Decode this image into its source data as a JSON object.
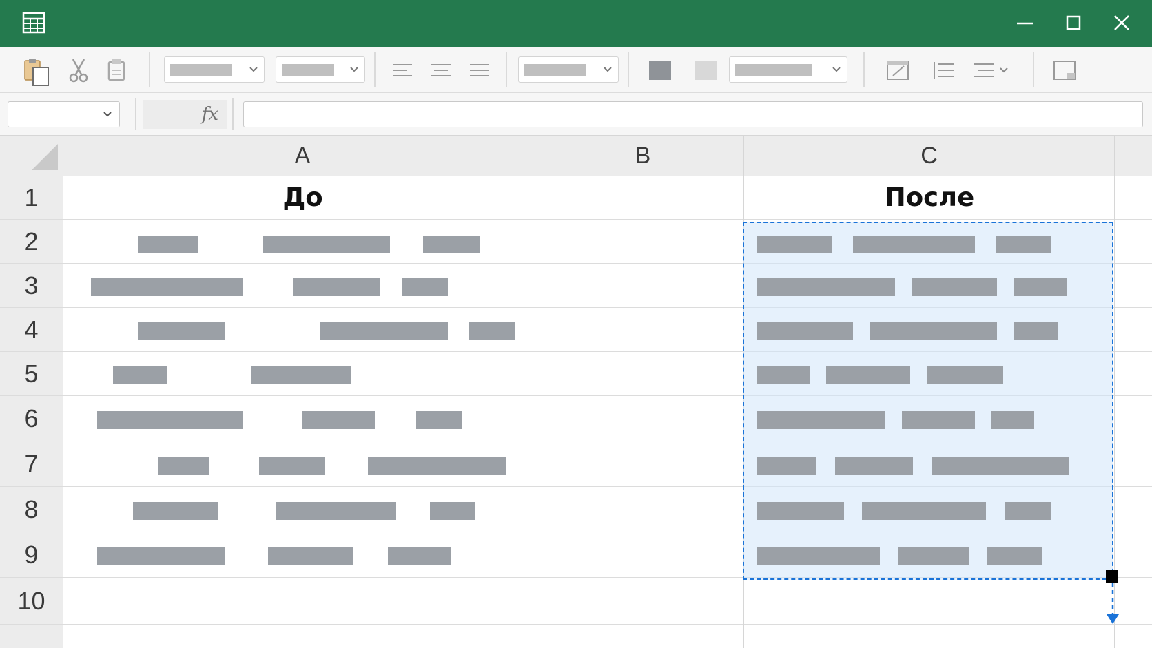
{
  "colors": {
    "titlebar": "#247a4e",
    "selection_border": "#1a73d8",
    "selection_fill": "#dcebfb",
    "placeholder_bar": "#9ba0a6"
  },
  "titlebar": {
    "app_icon": "spreadsheet-icon",
    "controls": [
      "minimize-icon",
      "maximize-icon",
      "close-icon"
    ]
  },
  "toolbar": {
    "icons": [
      "paste-icon",
      "cut-icon",
      "copy-icon",
      "align-left-icon",
      "align-center-icon",
      "align-justify-icon",
      "fill-color-icon",
      "font-color-icon",
      "format-table-icon",
      "list-icon",
      "indent-icon",
      "chart-icon"
    ],
    "dropdowns": [
      "font-family-dropdown",
      "font-size-dropdown",
      "number-format-dropdown",
      "style-dropdown",
      "indent-dropdown"
    ]
  },
  "formula_bar": {
    "name_box_value": "",
    "fx_label": "fx",
    "formula_value": ""
  },
  "sheet": {
    "columns": [
      "A",
      "B",
      "C"
    ],
    "rows": [
      "1",
      "2",
      "3",
      "4",
      "5",
      "6",
      "7",
      "8",
      "9",
      "10"
    ],
    "header_row": {
      "A": "До",
      "C": "После"
    },
    "selection": {
      "range_rows": "2-9",
      "column": "C",
      "state": "dashed-copy-marquee",
      "fill_direction": "down"
    }
  }
}
